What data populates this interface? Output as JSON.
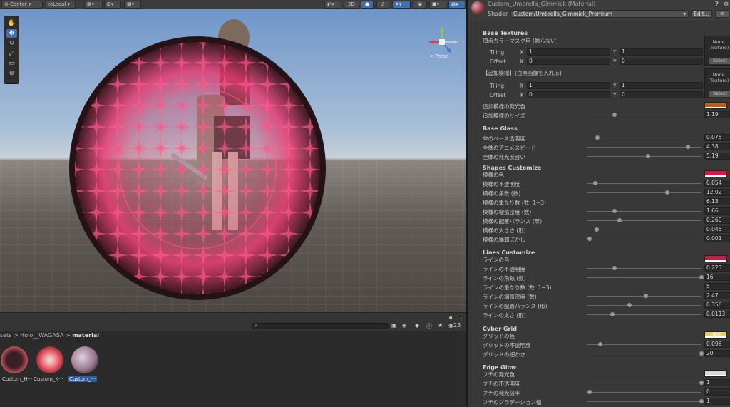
{
  "toolbar": {
    "pivot_label": "Center",
    "space_label": "Local",
    "mode_2d": "2D"
  },
  "scene": {
    "persp_label": "< Persp"
  },
  "project": {
    "breadcrumb_prefix": "sets > Holo__WAGASA > ",
    "breadcrumb_current": "material",
    "count": "23",
    "assets": [
      {
        "label": "Custom_H···",
        "selected": false
      },
      {
        "label": "Custom_K···",
        "selected": false
      },
      {
        "label": "Custom_···",
        "selected": true
      }
    ]
  },
  "inspector": {
    "title": "Custom_Umbrella_Gimmick (Material)",
    "shader_label": "Shader",
    "shader_value": "Custom/Umbrella_Gimmick_Premium",
    "edit_label": "Edit...",
    "tex_none": "None (Texture)",
    "tex_select": "Select",
    "base_textures": {
      "header": "Base Textures",
      "sub1": "頂点カラーマスク用 (触らない)",
      "tiling": "Tiling",
      "offset": "Offset",
      "x": "X",
      "y": "Y",
      "t1x": "1",
      "t1y": "1",
      "o1x": "0",
      "o1y": "0",
      "sub2": "【追加模様】(白黒画像を入れる)",
      "t2x": "1",
      "t2y": "1",
      "o2x": "0",
      "o2y": "0",
      "add_color": "追加模様の発光色",
      "add_size": "追加模様のサイズ",
      "add_size_val": "1.19",
      "add_color_hex": "#c0601c"
    },
    "base_glass": {
      "header": "Base Glass",
      "rows": [
        {
          "label": "傘のベース透明度",
          "value": "0.075",
          "pos": 0.09
        },
        {
          "label": "全体のアニメスピード",
          "value": "4.38",
          "pos": 0.88
        },
        {
          "label": "全体の発光度合い",
          "value": "5.19",
          "pos": 0.53
        }
      ]
    },
    "shapes": {
      "header": "Shapes Customize",
      "color_label": "模様の色",
      "color_hex": "#d01a4a",
      "rows": [
        {
          "label": "模様の不透明度",
          "value": "0.054",
          "pos": 0.07
        },
        {
          "label": "模様の角数 (数)",
          "value": "12.02",
          "pos": 0.7
        },
        {
          "label": "模様の重なり数 (数: 1~3)",
          "value": "6.13",
          "pos": null
        },
        {
          "label": "模様の増殖密度 (数)",
          "value": "1.66",
          "pos": 0.24
        },
        {
          "label": "模様の配置バランス (形)",
          "value": "0.269",
          "pos": 0.28
        },
        {
          "label": "模様の大きさ (形)",
          "value": "0.045",
          "pos": 0.08
        },
        {
          "label": "模様の輪郭ぼかし",
          "value": "0.001",
          "pos": 0.02
        }
      ]
    },
    "lines": {
      "header": "Lines Customize",
      "color_label": "ラインの色",
      "color_hex": "#c81e44",
      "rows": [
        {
          "label": "ラインの不透明度",
          "value": "0.223",
          "pos": 0.24
        },
        {
          "label": "ラインの角数 (数)",
          "value": "16",
          "pos": 1.0
        },
        {
          "label": "ラインの重なり数 (数: 1~3)",
          "value": "5",
          "pos": null
        },
        {
          "label": "ラインの増殖密度 (数)",
          "value": "2.47",
          "pos": 0.51
        },
        {
          "label": "ラインの配置バランス (形)",
          "value": "0.356",
          "pos": 0.37
        },
        {
          "label": "ラインの太さ (形)",
          "value": "0.0113",
          "pos": 0.22
        }
      ]
    },
    "cyber": {
      "header": "Cyber Grid",
      "color_label": "グリッドの色",
      "color_hex": "#e8d070",
      "hdr": "HDR",
      "rows": [
        {
          "label": "グリッドの不透明度",
          "value": "0.096",
          "pos": 0.11
        },
        {
          "label": "グリッドの細かさ",
          "value": "20",
          "pos": 1.0
        }
      ]
    },
    "edge": {
      "header": "Edge Glow",
      "color_label": "フチの発光色",
      "color_hex": "#d8d8d8",
      "rows": [
        {
          "label": "フチの不透明度",
          "value": "1",
          "pos": 1.0
        },
        {
          "label": "フチの発光倍率",
          "value": "0",
          "pos": 0.02
        },
        {
          "label": "フチのグラデーション幅",
          "value": "1",
          "pos": 1.0
        }
      ]
    }
  }
}
